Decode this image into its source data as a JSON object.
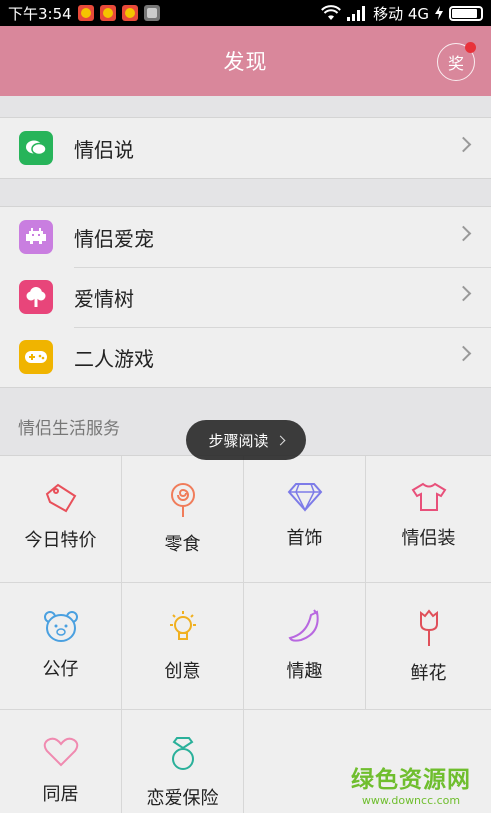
{
  "status_bar": {
    "time": "下午3:54",
    "carrier": "移动 4G",
    "battery_level": 0.9
  },
  "header": {
    "title": "发现",
    "award_label": "奖"
  },
  "groups": [
    {
      "items": [
        {
          "label": "情侣说",
          "icon": "chat-bubble-icon",
          "color": "#27b45a"
        }
      ]
    },
    {
      "items": [
        {
          "label": "情侣爱宠",
          "icon": "pet-invader-icon",
          "color": "#c97ee0"
        },
        {
          "label": "爱情树",
          "icon": "tree-icon",
          "color": "#e8457a"
        },
        {
          "label": "二人游戏",
          "icon": "gamepad-icon",
          "color": "#f0b400"
        }
      ]
    }
  ],
  "services": {
    "title": "情侣生活服务",
    "items": [
      {
        "label": "今日特价",
        "icon": "price-tag-icon"
      },
      {
        "label": "零食",
        "icon": "lollipop-icon"
      },
      {
        "label": "首饰",
        "icon": "diamond-icon"
      },
      {
        "label": "情侣装",
        "icon": "tshirt-icon"
      },
      {
        "label": "公仔",
        "icon": "bear-icon"
      },
      {
        "label": "创意",
        "icon": "lightbulb-icon"
      },
      {
        "label": "情趣",
        "icon": "banana-icon"
      },
      {
        "label": "鲜花",
        "icon": "rose-icon"
      },
      {
        "label": "同居",
        "icon": "heart-icon"
      },
      {
        "label": "恋爱保险",
        "icon": "ring-icon"
      }
    ]
  },
  "tooltip": {
    "label": "步骤阅读"
  },
  "watermark": {
    "name": "绿色资源网",
    "url": "www.downcc.com"
  }
}
